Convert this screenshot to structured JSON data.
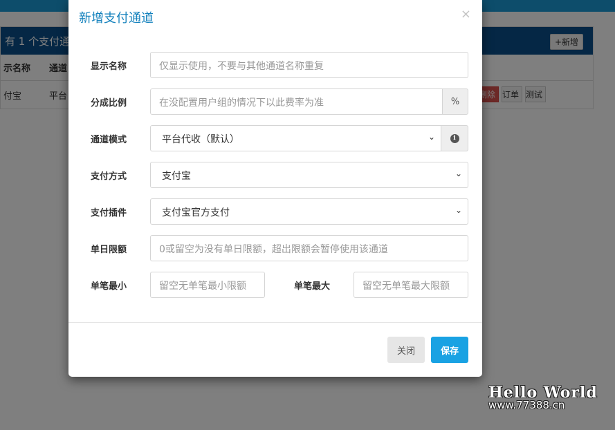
{
  "background": {
    "panel_title": "有 1 个支付通",
    "add_button": "+新增",
    "columns": [
      "示名称",
      "通道"
    ],
    "row": {
      "name": "付宝",
      "mode": "平台"
    },
    "actions": [
      "删除",
      "订单",
      "测试"
    ]
  },
  "modal": {
    "title": "新增支付通道",
    "close_icon": "×",
    "fields": {
      "display_name": {
        "label": "显示名称",
        "placeholder": "仅显示使用，不要与其他通道名称重复"
      },
      "ratio": {
        "label": "分成比例",
        "placeholder": "在没配置用户组的情况下以此费率为准",
        "addon": "%"
      },
      "channel_mode": {
        "label": "通道模式",
        "value": "平台代收（默认）",
        "info": "i"
      },
      "pay_method": {
        "label": "支付方式",
        "value": "支付宝"
      },
      "pay_plugin": {
        "label": "支付插件",
        "value": "支付宝官方支付"
      },
      "daily_limit": {
        "label": "单日限额",
        "placeholder": "0或留空为没有单日限额，超出限额会暂停使用该通道"
      },
      "min_amount": {
        "label": "单笔最小",
        "placeholder": "留空无单笔最小限额"
      },
      "max_amount": {
        "label": "单笔最大",
        "placeholder": "留空无单笔最大限额"
      }
    },
    "buttons": {
      "close": "关闭",
      "save": "保存"
    }
  },
  "watermark": {
    "line1": "Hello World",
    "line2": "www.77388.cn"
  },
  "colors": {
    "title": "#1582bd",
    "save_button": "#19a2e3",
    "panel_head": "#0b4f8a",
    "top_bar": "#1a9bd6"
  }
}
